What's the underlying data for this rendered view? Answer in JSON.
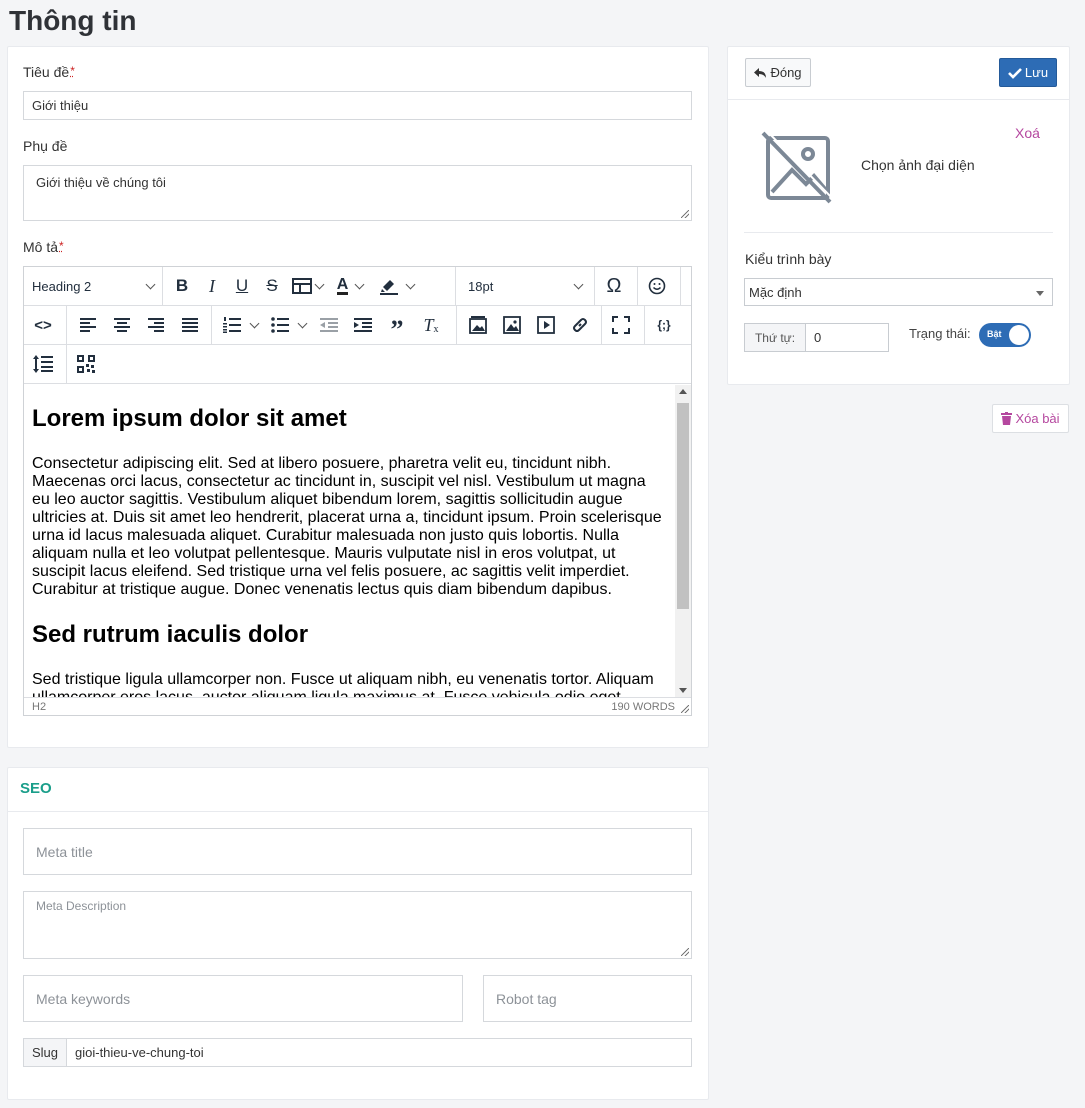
{
  "page_title": "Thông tin",
  "form": {
    "title_label": "Tiêu đề",
    "required_mark": "*",
    "title_value": "Giới thiệu",
    "subtitle_label": "Phụ đề",
    "subtitle_value": "Giới thiệu về chúng tôi",
    "description_label": "Mô tả"
  },
  "editor": {
    "block_format": "Heading 2",
    "font_size": "18pt",
    "toolbar_row1": [
      "bold-icon",
      "italic-icon",
      "underline-icon",
      "strikethrough-icon",
      "table-icon",
      "text-color-icon",
      "highlight-icon",
      "special-char-icon",
      "emoji-icon"
    ],
    "toolbar_row2": [
      "code-icon",
      "align-left-icon",
      "align-center-icon",
      "align-right-icon",
      "justify-icon",
      "numbered-list-icon",
      "bullet-list-icon",
      "outdent-icon",
      "indent-icon",
      "blockquote-icon",
      "clear-format-icon",
      "image-gallery-icon",
      "image-icon",
      "media-icon",
      "link-icon",
      "fullscreen-icon",
      "source-code-icon"
    ],
    "toolbar_row3": [
      "line-height-icon",
      "qr-icon"
    ],
    "content": {
      "heading1": "Lorem ipsum dolor sit amet",
      "para1": "Consectetur adipiscing elit. Sed at libero posuere, pharetra velit eu, tincidunt nibh. Maecenas orci lacus, consectetur ac tincidunt in, suscipit vel nisl. Vestibulum ut magna eu leo auctor sagittis. Vestibulum aliquet bibendum lorem, sagittis sollicitudin augue ultricies at. Duis sit amet leo hendrerit, placerat urna a, tincidunt ipsum. Proin scelerisque urna id lacus malesuada aliquet. Curabitur malesuada non justo quis lobortis. Nulla aliquam nulla et leo volutpat pellentesque. Mauris vulputate nisl in eros volutpat, ut suscipit lacus eleifend. Sed tristique urna vel felis posuere, ac sagittis velit imperdiet. Curabitur at tristique augue. Donec venenatis lectus quis diam bibendum dapibus.",
      "heading2": "Sed rutrum iaculis dolor",
      "para2": "Sed tristique ligula ullamcorper non. Fusce ut aliquam nibh, eu venenatis tortor. Aliquam ullamcorper eros lacus, auctor aliquam ligula maximus at. Fusce vehicula odio eget"
    },
    "status_path": "H2",
    "word_count": "190 WORDS"
  },
  "seo": {
    "heading": "SEO",
    "meta_title_placeholder": "Meta title",
    "meta_description_placeholder": "Meta Description",
    "meta_keywords_placeholder": "Meta keywords",
    "robot_tag_placeholder": "Robot tag",
    "slug_label": "Slug",
    "slug_value": "gioi-thieu-ve-chung-toi"
  },
  "side": {
    "close_label": "Đóng",
    "save_label": "Lưu",
    "delete_image_label": "Xoá",
    "choose_image_label": "Chọn ảnh đại diện",
    "layout_label": "Kiểu trình bày",
    "layout_value": "Mặc định",
    "order_label": "Thứ tự:",
    "order_value": "0",
    "status_label": "Trạng thái:",
    "toggle_label": "Bật",
    "delete_post_label": "Xóa bài"
  },
  "colors": {
    "primary": "#2d6cb5",
    "seo_heading": "#1a9e8a",
    "danger_text": "#b5479f"
  }
}
